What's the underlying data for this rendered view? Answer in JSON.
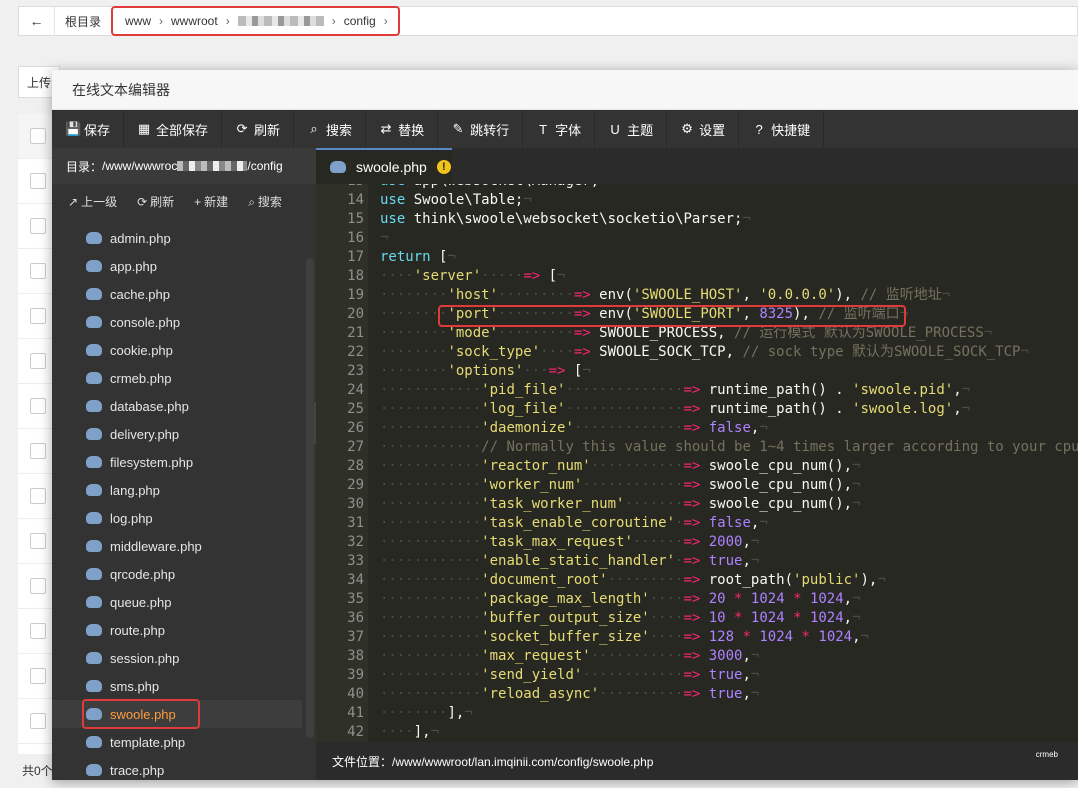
{
  "background": {
    "back_icon": "arrow-left-icon",
    "root_label": "根目录",
    "crumbs": [
      "www",
      "wwwroot",
      "config"
    ],
    "toolbar_buttons": [
      "上传"
    ],
    "footer": "共0个"
  },
  "editor": {
    "title": "在线文本编辑器",
    "tools": [
      {
        "icon": "save-icon",
        "glyph": "💾",
        "label": "保存"
      },
      {
        "icon": "save-all-icon",
        "glyph": "▦",
        "label": "全部保存"
      },
      {
        "icon": "refresh-icon",
        "glyph": "⟳",
        "label": "刷新"
      },
      {
        "icon": "search-icon",
        "glyph": "⌕",
        "label": "搜索"
      },
      {
        "icon": "replace-icon",
        "glyph": "⇄",
        "label": "替换"
      },
      {
        "icon": "pin-icon",
        "glyph": "✎",
        "label": "跳转行"
      },
      {
        "icon": "font-icon",
        "glyph": "T",
        "label": "字体"
      },
      {
        "icon": "theme-icon",
        "glyph": "U",
        "label": "主题"
      },
      {
        "icon": "gear-icon",
        "glyph": "⚙",
        "label": "设置"
      },
      {
        "icon": "help-icon",
        "glyph": "?",
        "label": "快捷键"
      }
    ],
    "sidebar": {
      "dir_label": "目录：",
      "dir_prefix": "/www/wwwroc",
      "dir_suffix": "/config",
      "actions": [
        {
          "icon": "arrow-up-icon",
          "glyph": "↗",
          "label": "上一级"
        },
        {
          "icon": "refresh-icon",
          "glyph": "⟳",
          "label": "刷新"
        },
        {
          "icon": "plus-icon",
          "glyph": "+",
          "label": "新建"
        },
        {
          "icon": "search-icon",
          "glyph": "⌕",
          "label": "搜索"
        }
      ],
      "files": [
        "admin.php",
        "app.php",
        "cache.php",
        "console.php",
        "cookie.php",
        "crmeb.php",
        "database.php",
        "delivery.php",
        "filesystem.php",
        "lang.php",
        "log.php",
        "middleware.php",
        "qrcode.php",
        "queue.php",
        "route.php",
        "session.php",
        "sms.php",
        "swoole.php",
        "template.php",
        "trace.php"
      ],
      "active_file": "swoole.php",
      "collapse_glyph": "‹"
    },
    "tab": {
      "label": "swoole.php",
      "warning": "!"
    },
    "status": "文件位置：/www/wwwroot/lan.imqinii.com/config/swoole.php",
    "brand": "crmeb"
  }
}
